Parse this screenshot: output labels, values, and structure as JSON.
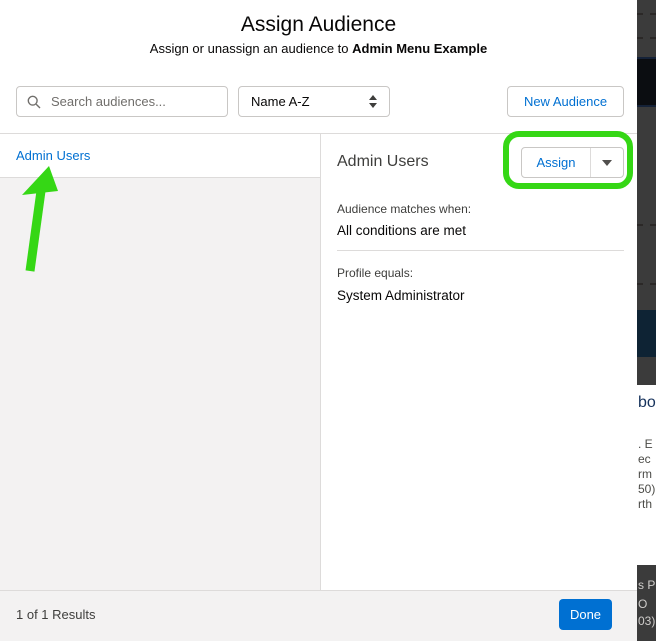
{
  "modal": {
    "title": "Assign Audience",
    "subtitle": {
      "prefix": "Assign or unassign an audience to ",
      "target": "Admin Menu Example"
    },
    "toolbar": {
      "search_placeholder": "Search audiences...",
      "sort_value": "Name A-Z",
      "new_audience_label": "New Audience"
    },
    "audience_list": {
      "items": [
        {
          "label": "Admin Users"
        }
      ]
    },
    "detail": {
      "heading": "Admin Users",
      "assign_label": "Assign",
      "matches_label": "Audience matches when:",
      "matches_value": "All conditions are met",
      "condition_label": "Profile equals:",
      "condition_value": "System Administrator"
    },
    "footer": {
      "results": "1 of 1 Results",
      "done_label": "Done"
    }
  },
  "background_page": {
    "fragments_white": [
      "bo",
      ". E",
      "ec",
      "rm",
      "50)",
      "rth"
    ],
    "fragments_dark": [
      "s P",
      "O",
      "03)"
    ]
  },
  "colors": {
    "link_blue": "#0070d2",
    "done_button_bg": "#0070d2",
    "annotation_green": "#35d715",
    "panel_gray": "#f3f2f2",
    "border_gray": "#dddbda",
    "strip_dark": "#3b3b3b",
    "strip_navy": "#0e2334",
    "fragment_navy": "#16325c"
  }
}
